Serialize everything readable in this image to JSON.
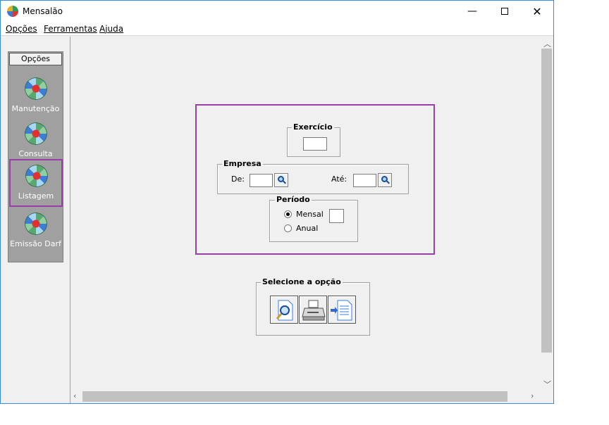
{
  "window": {
    "title": "Mensalão",
    "min_glyph": "—",
    "close_glyph": "✕"
  },
  "menu": {
    "items": [
      "Opções",
      "Ferramentas",
      "Ajuda"
    ]
  },
  "sidebar": {
    "header": "Opções",
    "items": [
      {
        "label": "Manutenção",
        "icon": "globe-icon"
      },
      {
        "label": "Consulta",
        "icon": "globe-icon"
      },
      {
        "label": "Listagem",
        "icon": "globe-icon",
        "selected": true
      },
      {
        "label": "Emissão Darf",
        "icon": "globe-icon"
      }
    ]
  },
  "form": {
    "exercicio": {
      "title": "Exercício",
      "value": ""
    },
    "empresa": {
      "title": "Empresa",
      "de_label": "De:",
      "ate_label": "Até:",
      "de_value": "",
      "ate_value": ""
    },
    "periodo": {
      "title": "Período",
      "options": [
        "Mensal",
        "Anual"
      ],
      "selected": "Mensal",
      "mensal_value": ""
    }
  },
  "actions": {
    "title": "Selecione a opção",
    "buttons": [
      "preview-icon",
      "printer-icon",
      "export-icon"
    ]
  },
  "colors": {
    "highlight": "#9b3fa8",
    "sidebar_bg": "#a0a0a0",
    "window_border": "#3c8ad8"
  }
}
